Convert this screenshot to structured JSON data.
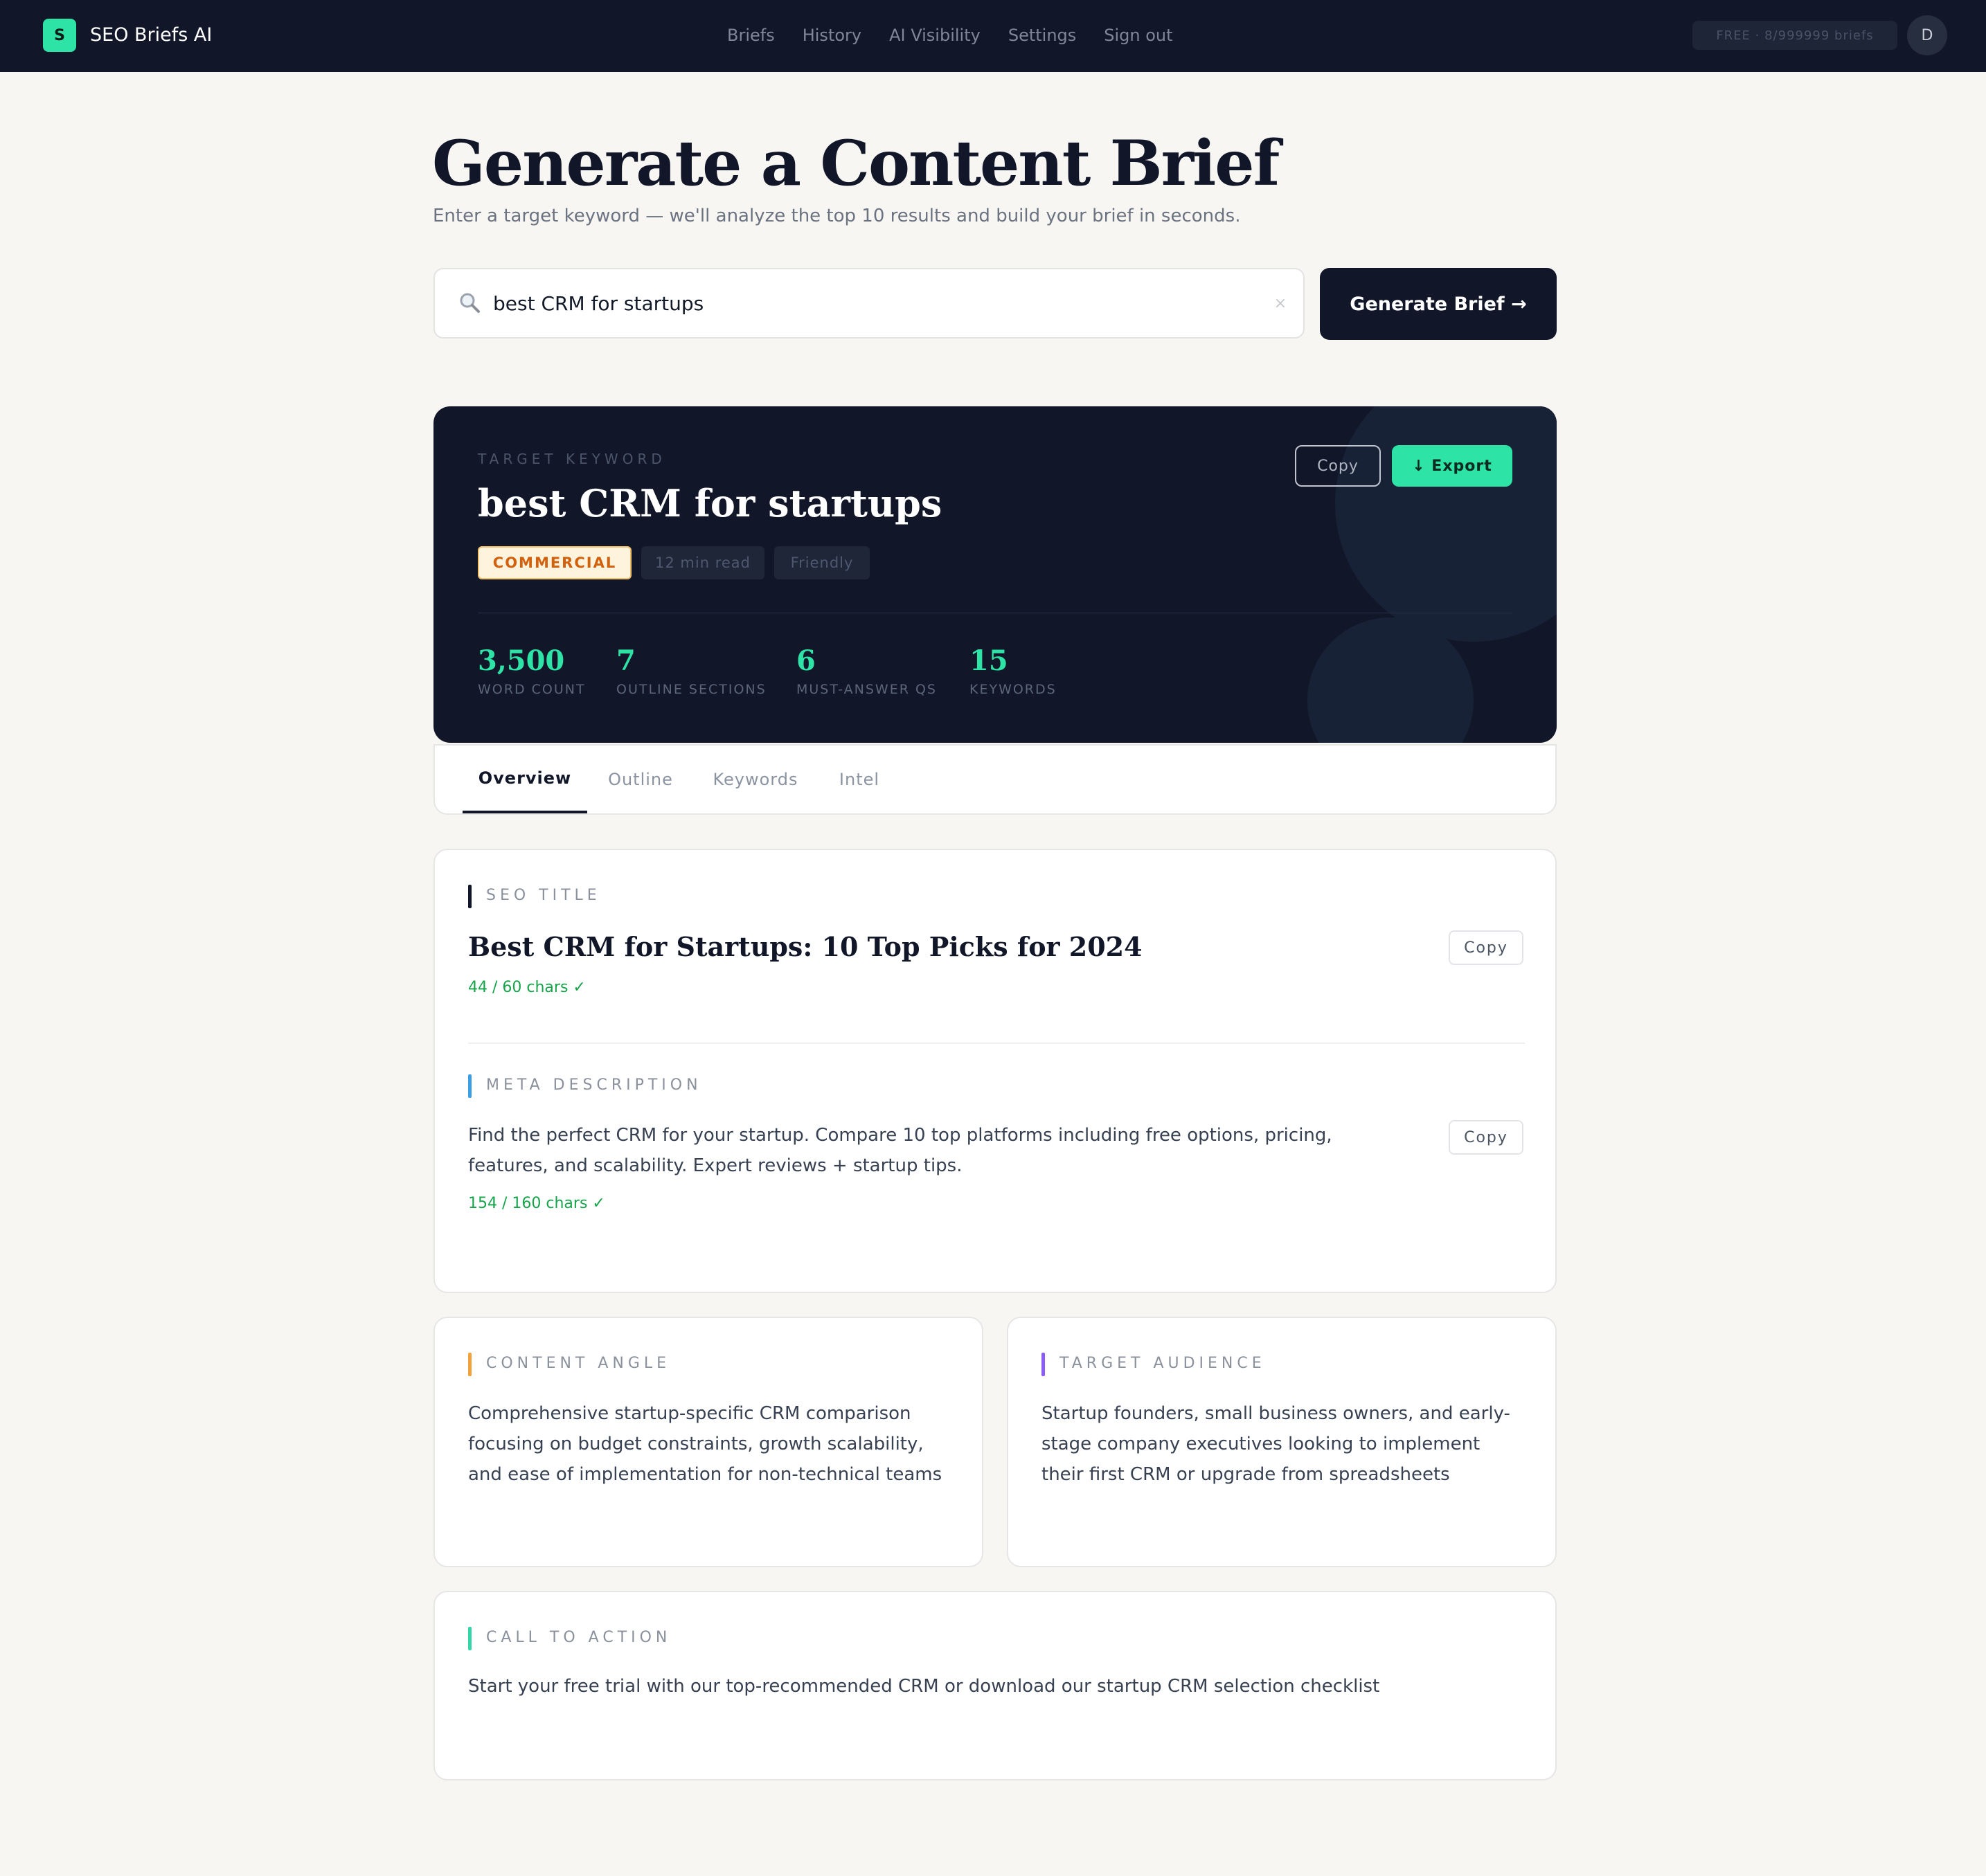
{
  "nav": {
    "logo_letter": "S",
    "app_name": "SEO Briefs AI",
    "links": [
      "Briefs",
      "History",
      "AI Visibility",
      "Settings",
      "Sign out"
    ],
    "plan_badge": "FREE · 8/999999 briefs",
    "avatar_initial": "D"
  },
  "header": {
    "title": "Generate a Content Brief",
    "subtitle": "Enter a target keyword — we'll analyze the top 10 results and build your brief in seconds."
  },
  "search": {
    "value": "best CRM for startups",
    "clear_symbol": "×",
    "button_label": "Generate Brief →"
  },
  "hero": {
    "label": "TARGET KEYWORD",
    "keyword": "best CRM for startups",
    "copy_label": "Copy",
    "export_label": "↓ Export",
    "tags": {
      "intent": "COMMERCIAL",
      "read_time": "12 min read",
      "tone": "Friendly"
    },
    "stats": [
      {
        "value": "3,500",
        "label": "WORD COUNT"
      },
      {
        "value": "7",
        "label": "OUTLINE SECTIONS"
      },
      {
        "value": "6",
        "label": "MUST-ANSWER QS"
      },
      {
        "value": "15",
        "label": "KEYWORDS"
      }
    ]
  },
  "tabs": [
    "Overview",
    "Outline",
    "Keywords",
    "Intel"
  ],
  "active_tab": "Overview",
  "seo_title": {
    "label": "SEO TITLE",
    "text": "Best CRM for Startups: 10 Top Picks for 2024",
    "char_count": "44 / 60 chars ✓",
    "copy_label": "Copy"
  },
  "meta_description": {
    "label": "META DESCRIPTION",
    "text": "Find the perfect CRM for your startup. Compare 10 top platforms including free options, pricing, features, and scalability. Expert reviews + startup tips.",
    "char_count": "154 / 160 chars ✓",
    "copy_label": "Copy"
  },
  "content_angle": {
    "label": "CONTENT ANGLE",
    "text": "Comprehensive startup-specific CRM comparison focusing on budget constraints, growth scalability, and ease of implementation for non-technical teams"
  },
  "target_audience": {
    "label": "TARGET AUDIENCE",
    "text": "Startup founders, small business owners, and early-stage company executives looking to implement their first CRM or upgrade from spreadsheets"
  },
  "call_to_action": {
    "label": "CALL TO ACTION",
    "text": "Start your free trial with our top-recommended CRM or download our startup CRM selection checklist"
  },
  "colors": {
    "accent": "#2de3a5",
    "dark": "#111729",
    "seo_title_bar": "#111729",
    "meta_bar": "#3b9fe8",
    "angle_bar": "#f2a13b",
    "audience_bar": "#8b5cf6",
    "cta_bar": "#34d8a8"
  }
}
